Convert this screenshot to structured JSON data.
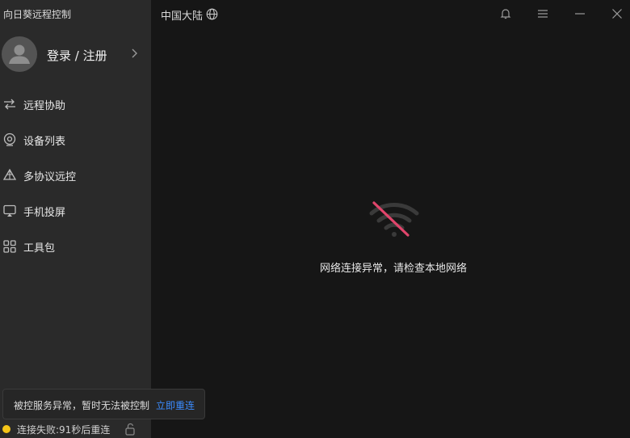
{
  "app": {
    "title": "向日葵远程控制"
  },
  "account": {
    "login_label": "登录 / 注册"
  },
  "sidebar": {
    "items": [
      {
        "label": "远程协助",
        "icon": "remote-assist-icon"
      },
      {
        "label": "设备列表",
        "icon": "device-list-icon"
      },
      {
        "label": "多协议远控",
        "icon": "multi-protocol-icon"
      },
      {
        "label": "手机投屏",
        "icon": "screen-cast-icon"
      },
      {
        "label": "工具包",
        "icon": "toolkit-icon"
      }
    ]
  },
  "header": {
    "region": "中国大陆"
  },
  "main": {
    "network_error": "网络连接异常，请检查本地网络"
  },
  "toast": {
    "message": "被控服务异常，暂时无法被控制",
    "action": "立即重连"
  },
  "status": {
    "text": "连接失败:91秒后重连",
    "dot_color": "#f5c518"
  },
  "colors": {
    "accent": "#3b8cff",
    "error_slash": "#e0456b"
  }
}
